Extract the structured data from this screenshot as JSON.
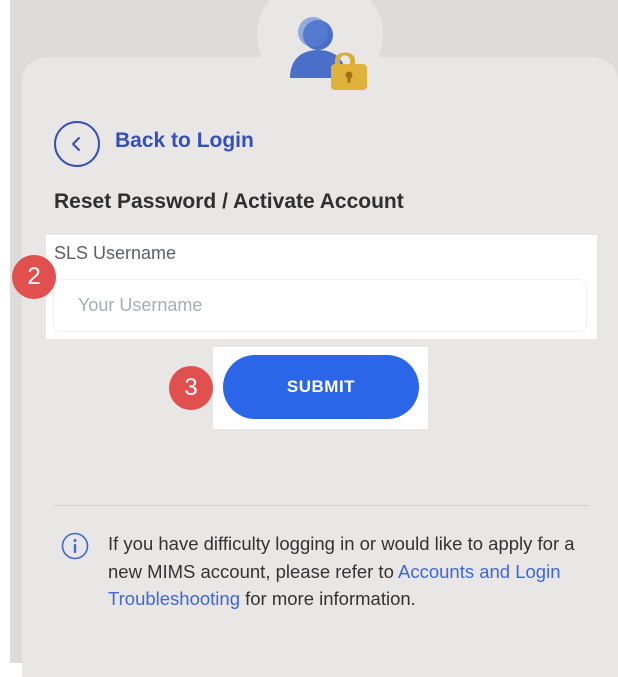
{
  "header": {
    "avatar_icon": "user-lock-icon"
  },
  "nav": {
    "back_icon": "chevron-left-icon",
    "back_label": "Back to Login"
  },
  "form": {
    "title": "Reset Password / Activate Account",
    "username_label": "SLS Username",
    "username_placeholder": "Your Username",
    "username_value": "",
    "submit_label": "SUBMIT"
  },
  "step_markers": [
    {
      "number": "2"
    },
    {
      "number": "3"
    }
  ],
  "info": {
    "icon": "info-icon",
    "text_before": "If you have difficulty logging in or would like to apply for a new MIMS account, please refer to ",
    "link_text": "Accounts and Login Troubleshooting",
    "text_after": " for more information."
  },
  "colors": {
    "accent": "#3550b7",
    "submit": "#2b65e8",
    "marker": "#e0504f",
    "background": "#dedbdb",
    "card": "#e9e6e6"
  }
}
